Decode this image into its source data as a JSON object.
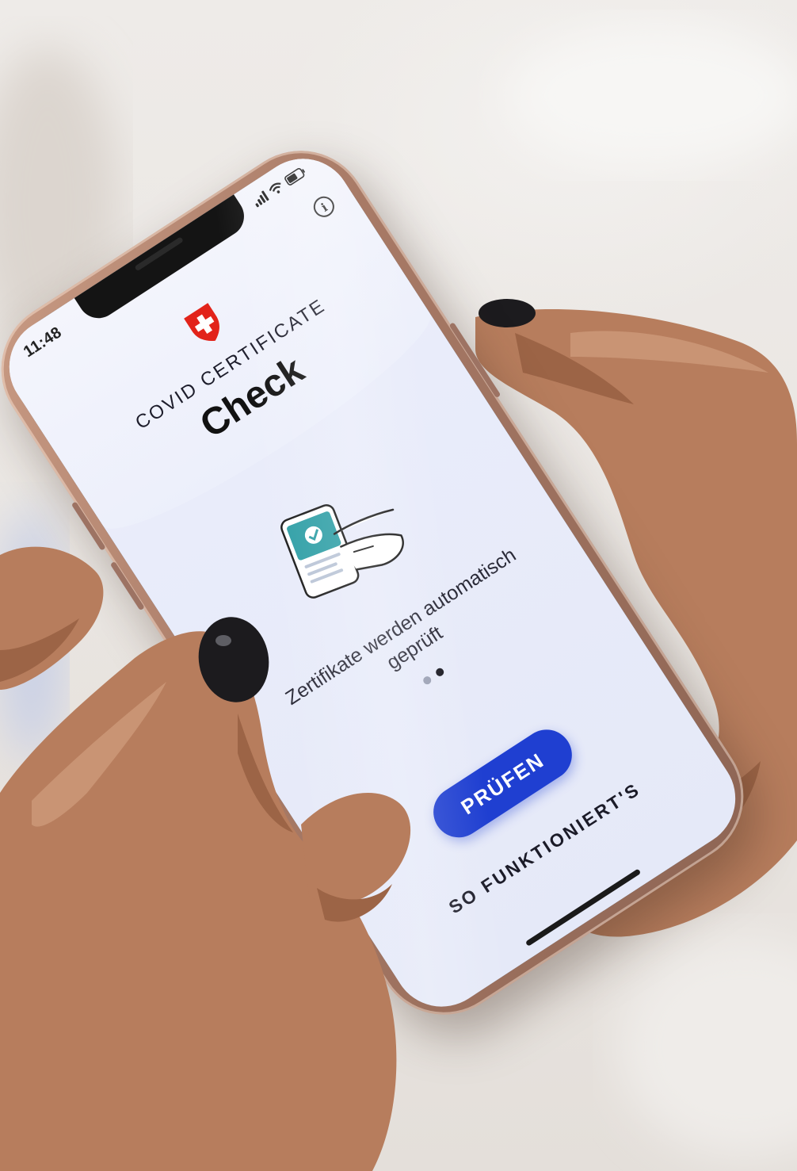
{
  "status_bar": {
    "time": "11:48"
  },
  "header": {
    "info_icon": "info-icon",
    "info_glyph": "i",
    "logo": "swiss-cross-shield-icon",
    "subtitle": "COVID CERTIFICATE",
    "title": "Check"
  },
  "onboarding": {
    "illustration": "phone-scan-hand-illustration",
    "text": "Zertifikate werden automatisch geprüft",
    "pages": 2,
    "active_page": 2
  },
  "actions": {
    "check_label": "PRÜFEN",
    "how_it_works_label": "SO FUNKTIONIERT'S"
  },
  "colors": {
    "accent": "#1f3fd1",
    "screen_bg": "#e9ecfa",
    "swiss_red": "#e2231a"
  }
}
